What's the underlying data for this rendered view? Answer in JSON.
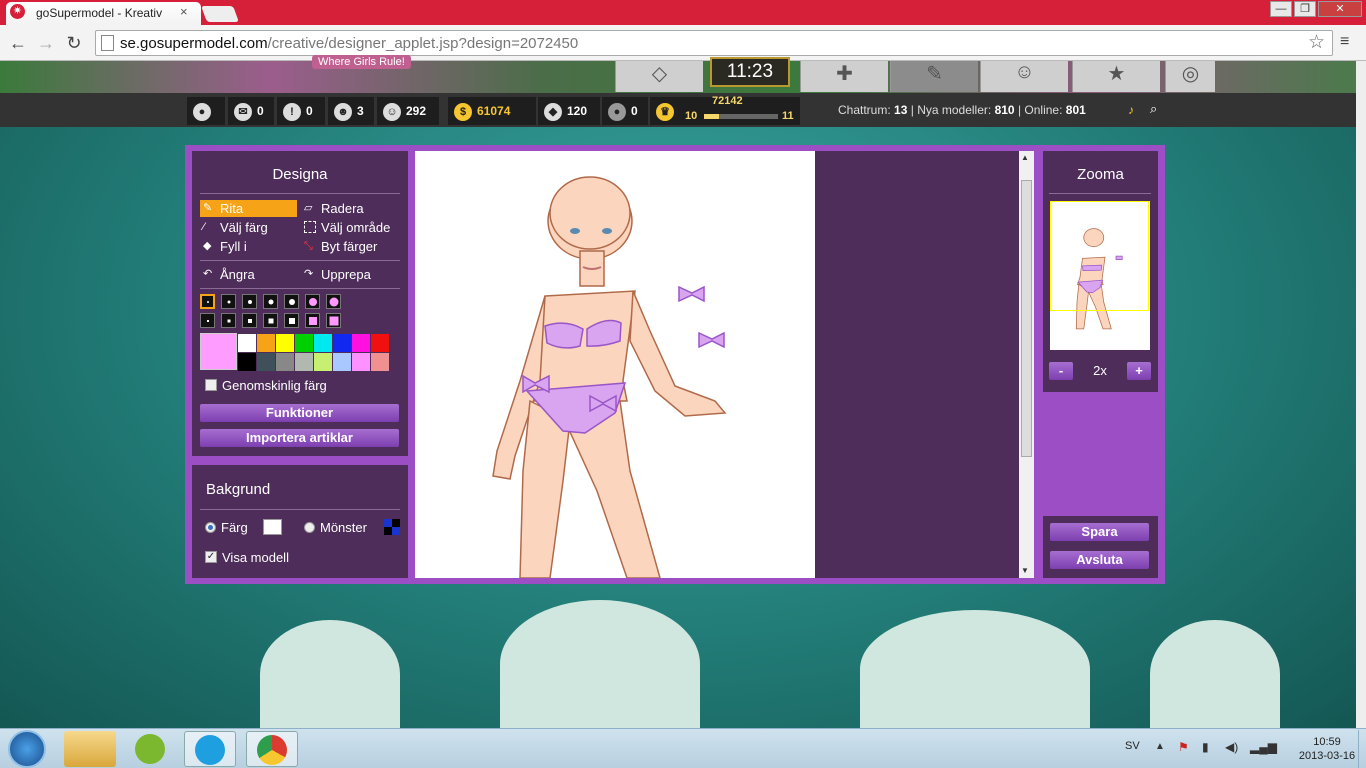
{
  "browser": {
    "tab_title": "goSupermodel - Kreativ",
    "close_glyph": "×",
    "url_host": "se.gosupermodel.com",
    "url_path": "/creative/designer_applet.jsp?design=2072450",
    "win_min": "—",
    "win_max": "❐",
    "win_close": "✕"
  },
  "site": {
    "tagline": "Where Girls Rule!",
    "clock": "11:23",
    "stats": {
      "mail": "0",
      "alerts": "0",
      "friends": "3",
      "smiles": "292",
      "coins": "61074",
      "diamonds": "120",
      "pearls": "0",
      "xp": "72142",
      "level_current": "10",
      "level_next": "11",
      "xp_progress": 0.2
    },
    "online_bar": {
      "chat_label": "Chattrum:",
      "chat": "13",
      "new_label": "Nya modeller:",
      "new": "810",
      "online_label": "Online:",
      "online": "801",
      "sep": "|"
    }
  },
  "designer": {
    "design_panel_title": "Designa",
    "tools": {
      "draw": "Rita",
      "erase": "Radera",
      "pick": "Välj färg",
      "select": "Välj område",
      "fill": "Fyll i",
      "swap": "Byt färger",
      "undo": "Ångra",
      "redo": "Upprepa"
    },
    "palette": [
      "#ffffff",
      "#f7a317",
      "#ffff00",
      "#00d000",
      "#00e8f0",
      "#1028f0",
      "#ff10e0",
      "#f01010",
      "#000000",
      "#40505a",
      "#888888",
      "#b0b8b0",
      "#c8f070",
      "#a8c8ff",
      "#ff90ff",
      "#f09090"
    ],
    "current_color": "#ff9cff",
    "transparent_label": "Genomskinlig färg",
    "functions_button": "Funktioner",
    "import_button": "Importera artiklar",
    "background_panel_title": "Bakgrund",
    "bg_color_label": "Färg",
    "bg_pattern_label": "Mönster",
    "show_model_label": "Visa modell",
    "zoom_panel_title": "Zooma",
    "zoom_minus": "-",
    "zoom_level": "2x",
    "zoom_plus": "+",
    "save_button": "Spara",
    "exit_button": "Avsluta"
  },
  "taskbar": {
    "lang": "SV",
    "time": "10:59",
    "date": "2013-03-16"
  }
}
